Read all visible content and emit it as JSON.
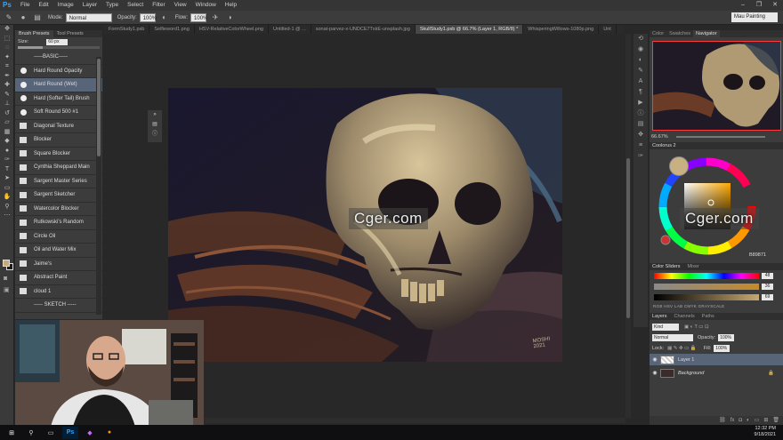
{
  "app": {
    "logo": "Ps"
  },
  "menu": [
    "File",
    "Edit",
    "Image",
    "Layer",
    "Type",
    "Select",
    "Filter",
    "View",
    "Window",
    "Help"
  ],
  "window_buttons": [
    "–",
    "❐",
    "✕"
  ],
  "options": {
    "mode_label": "Mode:",
    "mode_value": "Normal",
    "opacity_label": "Opacity:",
    "opacity_value": "100%",
    "flow_label": "Flow:",
    "flow_value": "100%",
    "workspace": "Mau Painting"
  },
  "doc_tabs": [
    {
      "label": "FormStudy1.psb",
      "active": false
    },
    {
      "label": "Selfieword1.png",
      "active": false
    },
    {
      "label": "HSV-RelativeColorWheel.png",
      "active": false
    },
    {
      "label": "Untitled-1 @ ...",
      "active": false
    },
    {
      "label": "sonat-parvez-x-UNDCE7TxkE-unsplash.jpg",
      "active": false
    },
    {
      "label": "SkullStudy1.psb @ 66.7% (Layer 1, RGB/8) *",
      "active": true
    },
    {
      "label": "WhisperingWillows-1080p.png",
      "active": false
    },
    {
      "label": "Unt",
      "active": false
    }
  ],
  "brush_panel": {
    "tabs": [
      "Brush Presets",
      "Tool Presets"
    ],
    "size_label": "Size:",
    "size_value": "60 px",
    "brushes": [
      {
        "name": "-----BASIC-----",
        "thumb": "none",
        "selected": false
      },
      {
        "name": "Hard Round Opacity",
        "thumb": "dot",
        "selected": false
      },
      {
        "name": "Hard Round (Wet)",
        "thumb": "dot",
        "selected": true
      },
      {
        "name": "Hard (Softer Tail) Brush",
        "thumb": "dot",
        "selected": false
      },
      {
        "name": "Soft Round 500 #1",
        "thumb": "dot",
        "selected": false
      },
      {
        "name": "Diagonal Texture",
        "thumb": "sq",
        "selected": false
      },
      {
        "name": "Blocker",
        "thumb": "sq",
        "selected": false
      },
      {
        "name": "Square Blocker",
        "thumb": "sq",
        "selected": false
      },
      {
        "name": "Cynthia Sheppard Main",
        "thumb": "sq",
        "selected": false
      },
      {
        "name": "Sargent Master Series",
        "thumb": "sq",
        "selected": false
      },
      {
        "name": "Sargent Sketcher",
        "thumb": "sq",
        "selected": false
      },
      {
        "name": "Watercolor Blocker",
        "thumb": "sq",
        "selected": false
      },
      {
        "name": "Rutkowski's Random",
        "thumb": "sq",
        "selected": false
      },
      {
        "name": "Circle Oil",
        "thumb": "sq",
        "selected": false
      },
      {
        "name": "Oil and Water Mix",
        "thumb": "sq",
        "selected": false
      },
      {
        "name": "Jaime's",
        "thumb": "sq",
        "selected": false
      },
      {
        "name": "Abstract Paint",
        "thumb": "sq",
        "selected": false
      },
      {
        "name": "cloud 1",
        "thumb": "sq",
        "selected": false
      },
      {
        "name": "----- SKETCH -----",
        "thumb": "none",
        "selected": false
      }
    ]
  },
  "right_panels": {
    "nav_tabs": [
      "Color",
      "Swatches",
      "Navigator"
    ],
    "zoom": "66.67%",
    "coolorus_title": "Coolorus 2",
    "hex": "B89871",
    "slider_tabs": [
      "Color Sliders",
      "Mixer"
    ],
    "slider_values": [
      "48",
      "36",
      "69"
    ],
    "slider_modes": "RGB   HSV   LAB   CMYK   GRAYSCALE",
    "layers_tabs": [
      "Layers",
      "Channels",
      "Paths"
    ],
    "kind_label": "Kind",
    "blend_mode": "Normal",
    "opacity_label": "Opacity:",
    "opacity_value": "100%",
    "lock_label": "Lock:",
    "fill_label": "Fill:",
    "fill_value": "100%",
    "layers": [
      {
        "name": "Layer 1",
        "selected": true
      },
      {
        "name": "Background",
        "selected": false
      }
    ]
  },
  "watermark": "Cger.com",
  "signature": "MOSHI 2021",
  "clock": {
    "time": "12:32 PM",
    "date": "9/18/2021"
  },
  "colors": {
    "selection": "#586478",
    "accent": "#31a8ff",
    "nav_frame": "#ff3a3a",
    "foreground": "#c7aa78"
  }
}
